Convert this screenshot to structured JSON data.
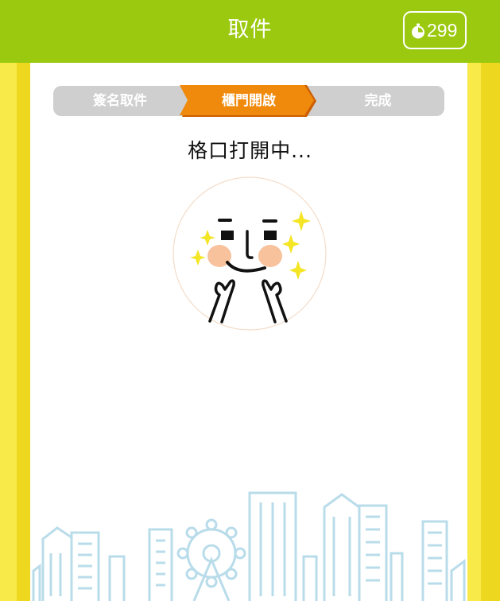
{
  "header": {
    "title": "取件",
    "timer": {
      "icon": "timer-icon",
      "value": "299"
    }
  },
  "steps": [
    {
      "label": "簽名取件",
      "active": false
    },
    {
      "label": "櫃門開啟",
      "active": true
    },
    {
      "label": "完成",
      "active": false
    }
  ],
  "status": {
    "text": "格口打開中..."
  },
  "colors": {
    "header": "#9bc90f",
    "active_step": "#f08a0d",
    "inactive_step": "#cfcfcf",
    "side_band": "#f8ea49",
    "skyline": "#b9dcea"
  }
}
